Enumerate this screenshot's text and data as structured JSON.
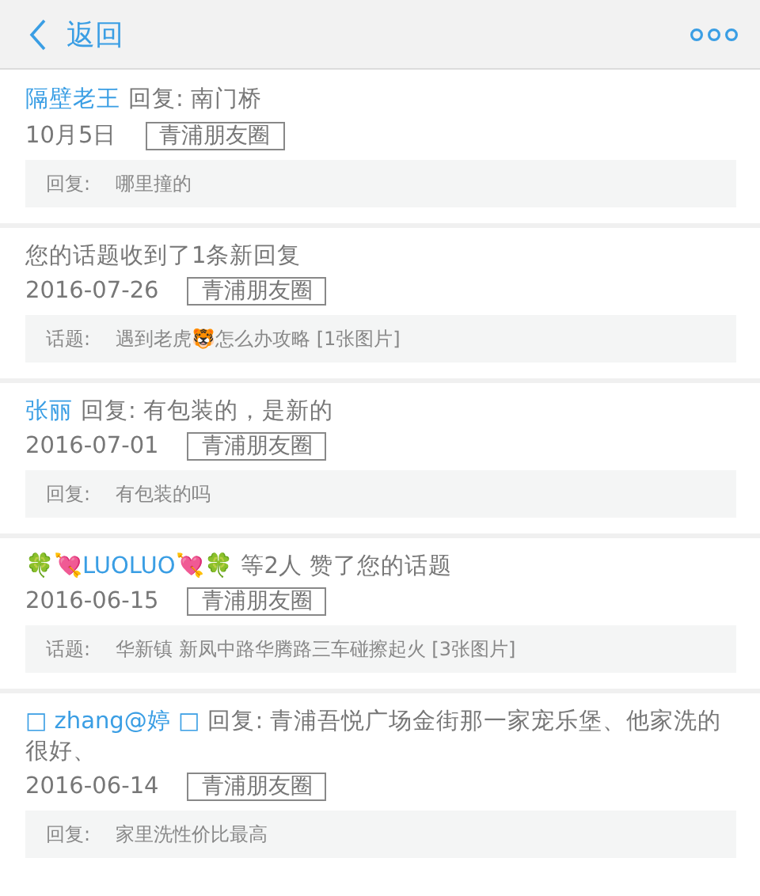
{
  "header": {
    "back_label": "返回"
  },
  "notices": [
    {
      "name": "隔壁老王",
      "text": "回复: 南门桥",
      "date": "10月5日",
      "tag": "青浦朋友圈",
      "quote_label": "回复:",
      "quote_text": "哪里撞的"
    },
    {
      "text": "您的话题收到了1条新回复",
      "date": "2016-07-26",
      "tag": "青浦朋友圈",
      "quote_label": "话题:",
      "quote_text": "遇到老虎🐯怎么办攻略 [1张图片]"
    },
    {
      "name": "张丽",
      "text": "回复: 有包装的，是新的",
      "date": "2016-07-01",
      "tag": "青浦朋友圈",
      "quote_label": "回复:",
      "quote_text": "有包装的吗"
    },
    {
      "name": "🍀💘LUOLUO💘🍀",
      "text": "等2人 赞了您的话题",
      "date": "2016-06-15",
      "tag": "青浦朋友圈",
      "quote_label": "话题:",
      "quote_text": "华新镇 新凤中路华腾路三车碰擦起火 [3张图片]"
    },
    {
      "name": "□ zhang@婷 □",
      "text": "回复: 青浦吾悦广场金街那一家宠乐堡、他家洗的很好、",
      "date": "2016-06-14",
      "tag": "青浦朋友圈",
      "quote_label": "回复:",
      "quote_text": "家里洗性价比最高"
    }
  ]
}
